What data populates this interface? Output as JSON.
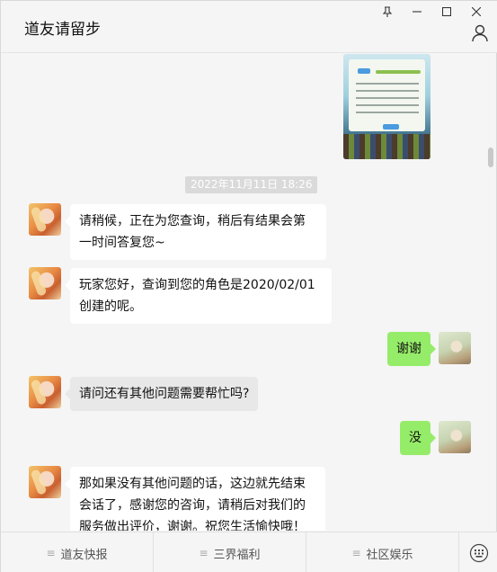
{
  "window": {
    "title": "道友请留步"
  },
  "controls": {
    "pin": "⊥",
    "minimize": "—",
    "maximize": "□",
    "close": "✕"
  },
  "chat": {
    "timestamp": "2022年11月11日  18:26",
    "messages": [
      {
        "from": "service",
        "text": "请稍候，正在为您查询，稍后有结果会第一时间答复您~"
      },
      {
        "from": "service",
        "text": "玩家您好，查询到您的角色是2020/02/01创建的呢。"
      },
      {
        "from": "me",
        "text": "谢谢"
      },
      {
        "from": "service",
        "text": "请问还有其他问题需要帮忙吗?"
      },
      {
        "from": "me",
        "text": "没"
      },
      {
        "from": "service",
        "text": "那如果没有其他问题的话，这边就先结束会话了，感谢您的咨询，请稍后对我们的服务做出评价，谢谢。祝您生活愉快哦！",
        "emoji": "🌹"
      }
    ]
  },
  "menu": {
    "items": [
      {
        "label": "道友快报"
      },
      {
        "label": "三界福利"
      },
      {
        "label": "社区娱乐"
      }
    ],
    "keyboard_icon": "keyboard-icon",
    "menu_icon": "≡"
  },
  "icons": {
    "contact": "person-icon"
  },
  "colors": {
    "bubble_right": "#95ec69",
    "bubble_left": "#ffffff",
    "background": "#f5f5f5"
  }
}
